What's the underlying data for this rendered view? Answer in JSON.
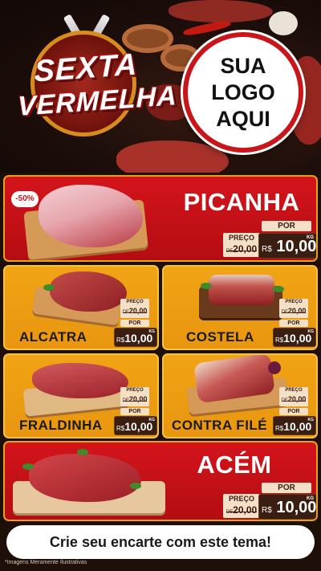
{
  "emblem": {
    "line1": "SEXTA",
    "line2": "VERMELHA"
  },
  "logo": {
    "line1": "SUA",
    "line2": "LOGO",
    "line3": "AQUI"
  },
  "currency": "R$",
  "products": [
    {
      "name": "PICANHA",
      "badge": "-50%",
      "por_label": "POR",
      "preco_label": "PREÇO",
      "de_label": "DE",
      "old_price": "20,00",
      "price": "10,00",
      "unit": "KG"
    },
    {
      "name": "ALCATRA",
      "por_label": "POR",
      "preco_label": "PREÇO",
      "de_label": "DE",
      "old_price": "20,00",
      "price": "10,00",
      "unit": "KG"
    },
    {
      "name": "COSTELA",
      "por_label": "POR",
      "preco_label": "PREÇO",
      "de_label": "DE",
      "old_price": "20,00",
      "price": "10,00",
      "unit": "KG"
    },
    {
      "name": "FRALDINHA",
      "por_label": "POR",
      "preco_label": "PREÇO",
      "de_label": "DE",
      "old_price": "20,00",
      "price": "10,00",
      "unit": "KG"
    },
    {
      "name": "CONTRA FILÉ",
      "por_label": "POR",
      "preco_label": "PREÇO",
      "de_label": "DE",
      "old_price": "20,00",
      "price": "10,00",
      "unit": "KG"
    },
    {
      "name": "ACÉM",
      "por_label": "POR",
      "preco_label": "PREÇO",
      "de_label": "DE",
      "old_price": "20,00",
      "price": "10,00",
      "unit": "KG"
    }
  ],
  "footer": {
    "cta": "Crie seu encarte com este tema!",
    "disclaimer": "*Imagens Meramente Ilustrativas"
  },
  "colors": {
    "red": "#d4141b",
    "gold": "#f0a414",
    "dark": "#1e1008",
    "price_bg": "#3b1e12"
  }
}
